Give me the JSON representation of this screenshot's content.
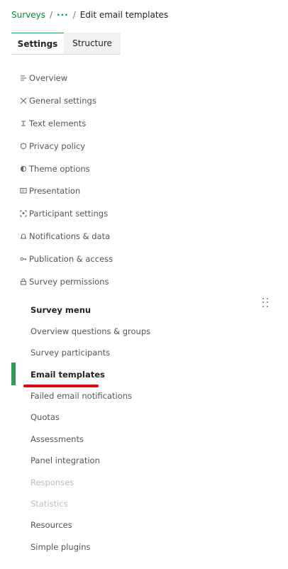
{
  "breadcrumb": {
    "root": "Surveys",
    "sep1": "/",
    "dots": "···",
    "sep2": "/",
    "current": "Edit email templates"
  },
  "tabs": [
    {
      "label": "Settings"
    },
    {
      "label": "Structure"
    }
  ],
  "settings_items": [
    {
      "label": "Overview",
      "icon": "list-icon"
    },
    {
      "label": "General settings",
      "icon": "tools-icon"
    },
    {
      "label": "Text elements",
      "icon": "text-icon"
    },
    {
      "label": "Privacy policy",
      "icon": "shield-icon"
    },
    {
      "label": "Theme options",
      "icon": "contrast-icon"
    },
    {
      "label": "Presentation",
      "icon": "presentation-icon"
    },
    {
      "label": "Participant settings",
      "icon": "participant-icon"
    },
    {
      "label": "Notifications & data",
      "icon": "bell-icon"
    },
    {
      "label": "Publication & access",
      "icon": "key-icon"
    },
    {
      "label": "Survey permissions",
      "icon": "lock-icon"
    }
  ],
  "survey_menu": {
    "title": "Survey menu",
    "items": [
      {
        "label": "Overview questions & groups",
        "state": "normal"
      },
      {
        "label": "Survey participants",
        "state": "normal"
      },
      {
        "label": "Email templates",
        "state": "active"
      },
      {
        "label": "Failed email notifications",
        "state": "normal"
      },
      {
        "label": "Quotas",
        "state": "normal"
      },
      {
        "label": "Assessments",
        "state": "normal"
      },
      {
        "label": "Panel integration",
        "state": "normal"
      },
      {
        "label": "Responses",
        "state": "disabled"
      },
      {
        "label": "Statistics",
        "state": "disabled"
      },
      {
        "label": "Resources",
        "state": "normal"
      },
      {
        "label": "Simple plugins",
        "state": "normal"
      }
    ]
  },
  "colors": {
    "accent_green": "#2e9c56",
    "link_green": "#0c8a3a",
    "highlight_red": "#e30613"
  }
}
